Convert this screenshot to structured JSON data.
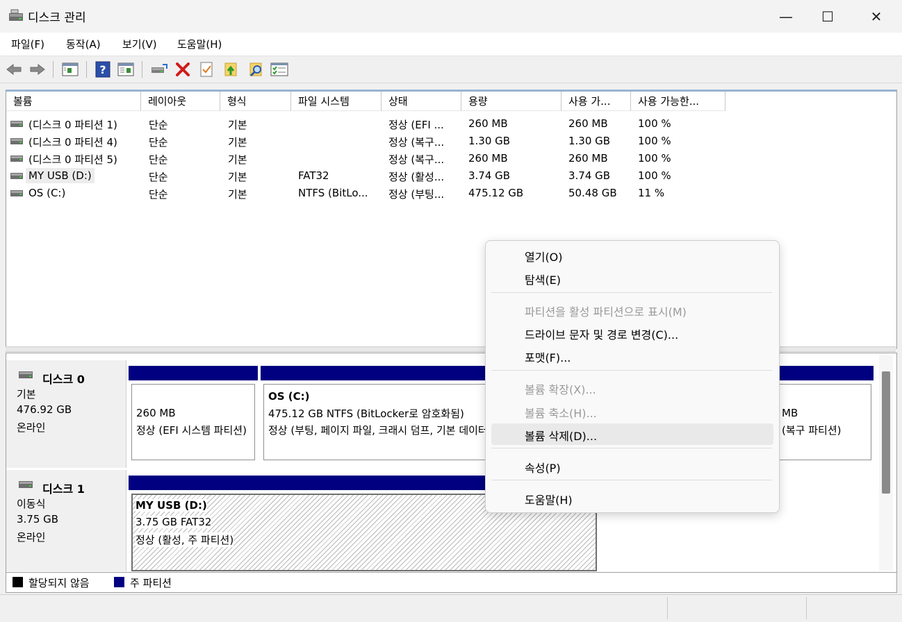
{
  "window": {
    "title": "디스크 관리",
    "controls": {
      "minimize": "—",
      "maximize": "☐",
      "close": "✕"
    }
  },
  "menu": [
    "파일(F)",
    "동작(A)",
    "보기(V)",
    "도움말(H)"
  ],
  "toolbar": {
    "icons": [
      "back-icon",
      "forward-icon",
      "disk-list-icon",
      "help-icon",
      "console-view-icon",
      "connect-drive-icon",
      "delete-icon",
      "checklist-icon",
      "folder-up-icon",
      "folder-search-icon",
      "properties-list-icon"
    ]
  },
  "volume_list": {
    "columns": [
      "볼륨",
      "레이아웃",
      "형식",
      "파일 시스템",
      "상태",
      "용량",
      "사용 가...",
      "사용 가능한..."
    ],
    "rows": [
      {
        "volume": "(디스크 0 파티션 1)",
        "layout": "단순",
        "type": "기본",
        "fs": "",
        "status": "정상 (EFI ...",
        "capacity": "260 MB",
        "free": "260 MB",
        "pct": "100 %"
      },
      {
        "volume": "(디스크 0 파티션 4)",
        "layout": "단순",
        "type": "기본",
        "fs": "",
        "status": "정상 (복구...",
        "capacity": "1.30 GB",
        "free": "1.30 GB",
        "pct": "100 %"
      },
      {
        "volume": "(디스크 0 파티션 5)",
        "layout": "단순",
        "type": "기본",
        "fs": "",
        "status": "정상 (복구...",
        "capacity": "260 MB",
        "free": "260 MB",
        "pct": "100 %"
      },
      {
        "volume": "MY USB (D:)",
        "layout": "단순",
        "type": "기본",
        "fs": "FAT32",
        "status": "정상 (활성...",
        "capacity": "3.74 GB",
        "free": "3.74 GB",
        "pct": "100 %"
      },
      {
        "volume": "OS (C:)",
        "layout": "단순",
        "type": "기본",
        "fs": "NTFS (BitLo...",
        "status": "정상 (부팅...",
        "capacity": "475.12 GB",
        "free": "50.48 GB",
        "pct": "11 %"
      }
    ]
  },
  "disks": {
    "disk0": {
      "name": "디스크 0",
      "kind": "기본",
      "size": "476.92 GB",
      "state": "온라인",
      "partitions": {
        "efi": {
          "size": "260 MB",
          "status": "정상 (EFI 시스템 파티션)"
        },
        "os": {
          "name": "OS (C:)",
          "detail": "475.12 GB NTFS (BitLocker로 암호화됨)",
          "status": "정상 (부팅, 페이지 파일, 크래시 덤프, 기본 데이터 파티션)"
        },
        "recovery": {
          "size": "MB",
          "status": "(복구 파티션)"
        }
      }
    },
    "disk1": {
      "name": "디스크 1",
      "kind": "이동식",
      "size": "3.75 GB",
      "state": "온라인",
      "partitions": {
        "usb": {
          "name": "MY USB (D:)",
          "detail": "3.75 GB FAT32",
          "status": "정상 (활성, 주 파티션)"
        }
      }
    }
  },
  "legend": [
    {
      "label": "할당되지 않음",
      "color": "#000000"
    },
    {
      "label": "주 파티션",
      "color": "#000080"
    }
  ],
  "context_menu": {
    "items": [
      {
        "label": "열기(O)",
        "enabled": true
      },
      {
        "label": "탐색(E)",
        "enabled": true
      },
      {
        "label": "파티션을 활성 파티션으로 표시(M)",
        "enabled": false
      },
      {
        "label": "드라이브 문자 및 경로 변경(C)...",
        "enabled": true
      },
      {
        "label": "포맷(F)...",
        "enabled": true
      },
      {
        "label": "볼륨 확장(X)...",
        "enabled": false
      },
      {
        "label": "볼륨 축소(H)...",
        "enabled": false
      },
      {
        "label": "볼륨 삭제(D)...",
        "enabled": true,
        "highlighted": true
      },
      {
        "label": "속성(P)",
        "enabled": true
      },
      {
        "label": "도움말(H)",
        "enabled": true
      }
    ]
  },
  "colors": {
    "primary_partition": "#000080",
    "unallocated": "#000000",
    "header_accent": "#99b4d1"
  }
}
